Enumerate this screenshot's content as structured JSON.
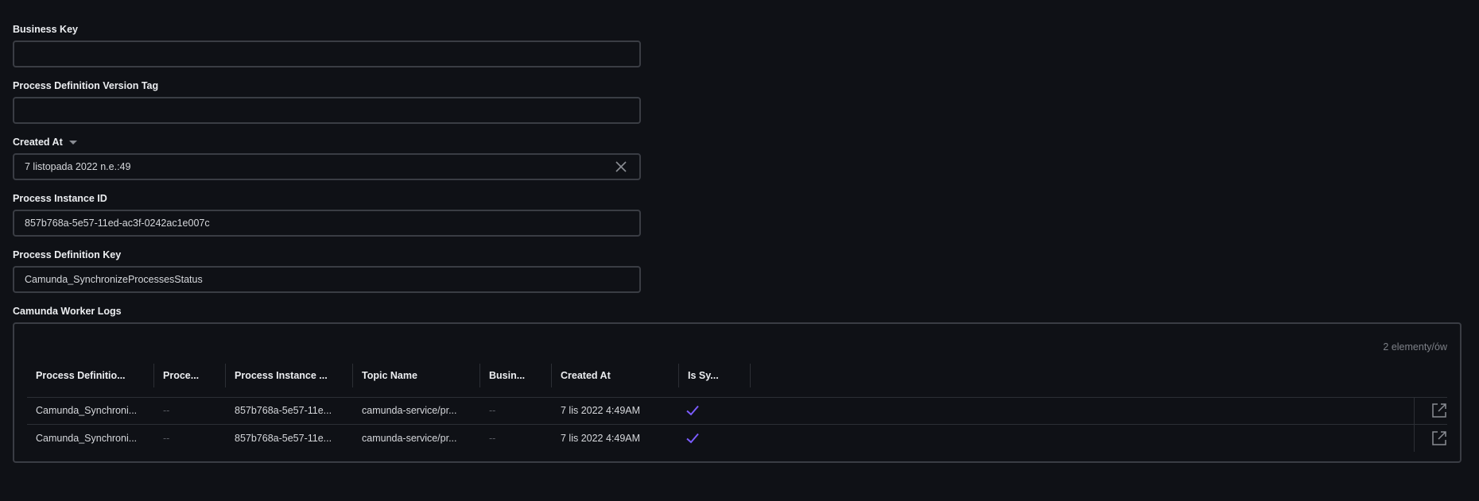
{
  "form": {
    "business_key": {
      "label": "Business Key",
      "value": ""
    },
    "version_tag": {
      "label": "Process Definition Version Tag",
      "value": ""
    },
    "created_at": {
      "label": "Created At",
      "value": "7 listopada 2022 n.e.:49"
    },
    "instance_id": {
      "label": "Process Instance ID",
      "value": "857b768a-5e57-11ed-ac3f-0242ac1e007c"
    },
    "definition_key": {
      "label": "Process Definition Key",
      "value": "Camunda_SynchronizeProcessesStatus"
    }
  },
  "logs": {
    "title": "Camunda Worker Logs",
    "count_text": "2 elementy/ów",
    "columns": [
      "Process Definitio...",
      "Proce...",
      "Process Instance ...",
      "Topic Name",
      "Busin...",
      "Created At",
      "Is Sy..."
    ],
    "rows": [
      {
        "definition": "Camunda_Synchroni...",
        "proc": "--",
        "instance": "857b768a-5e57-11e...",
        "topic": "camunda-service/pr...",
        "business": "--",
        "created": "7 lis 2022 4:49AM",
        "is_sync": true
      },
      {
        "definition": "Camunda_Synchroni...",
        "proc": "--",
        "instance": "857b768a-5e57-11e...",
        "topic": "camunda-service/pr...",
        "business": "--",
        "created": "7 lis 2022 4:49AM",
        "is_sync": true
      }
    ]
  },
  "colors": {
    "background": "#0f1116",
    "border": "#3a3d44",
    "check": "#7b5cff"
  },
  "icons": {
    "dropdown": "caret-down-icon",
    "clear": "close-icon",
    "check": "check-icon",
    "open": "open-in-new-icon"
  }
}
